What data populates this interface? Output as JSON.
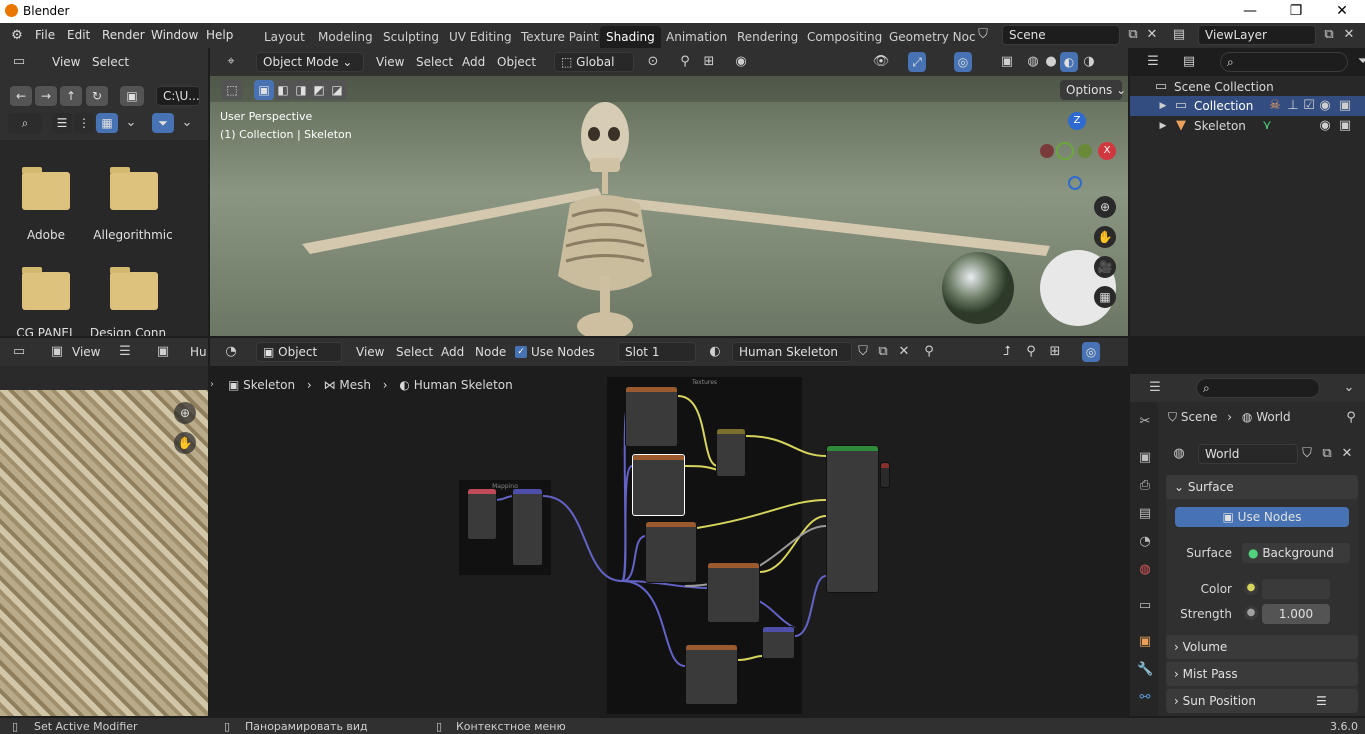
{
  "window": {
    "title": "Blender",
    "minimize": "—",
    "restore": "❐",
    "close": "✕"
  },
  "menubar": [
    "File",
    "Edit",
    "Render",
    "Window",
    "Help"
  ],
  "workspaces": [
    "Layout",
    "Modeling",
    "Sculpting",
    "UV Editing",
    "Texture Paint",
    "Shading",
    "Animation",
    "Rendering",
    "Compositing",
    "Geometry Noc"
  ],
  "active_workspace": "Shading",
  "scene": {
    "name": "Scene",
    "viewlayer": "ViewLayer"
  },
  "filebrowser": {
    "menus": [
      "View",
      "Select"
    ],
    "path": "C:\\U...",
    "folders": [
      "Adobe",
      "Allegorithmic",
      "CG PANEL",
      "Design Conn"
    ]
  },
  "viewport": {
    "mode": "Object Mode",
    "menus": [
      "View",
      "Select",
      "Add",
      "Object"
    ],
    "orientation": "Global",
    "options": "Options",
    "overlay_line1": "User Perspective",
    "overlay_line2": "(1) Collection | Skeleton",
    "gizmo_z": "Z",
    "gizmo_x": "X"
  },
  "outliner": {
    "root": "Scene Collection",
    "items": [
      "Collection",
      "Skeleton"
    ]
  },
  "image_editor": {
    "view": "View",
    "truncated": "Hu"
  },
  "node_editor": {
    "mode": "Object",
    "menus": [
      "View",
      "Select",
      "Add",
      "Node"
    ],
    "use_nodes": "Use Nodes",
    "slot": "Slot 1",
    "material": "Human Skeleton",
    "breadcrumb": [
      "Skeleton",
      "Mesh",
      "Human Skeleton"
    ],
    "frame_textures": "Textures",
    "frame_mapping": "Mapping"
  },
  "properties": {
    "breadcrumb": [
      "Scene",
      "World"
    ],
    "world": "World",
    "surface_section": "Surface",
    "use_nodes": "Use Nodes",
    "surface_label": "Surface",
    "surface_value": "Background",
    "color_label": "Color",
    "strength_label": "Strength",
    "strength_value": "1.000",
    "sections": [
      "Volume",
      "Mist Pass",
      "Sun Position"
    ],
    "accent": "#4772b3"
  },
  "statusbar": {
    "left": "Set Active Modifier",
    "middle": "Панорамировать вид",
    "right": "Контекстное меню",
    "version": "3.6.0"
  }
}
